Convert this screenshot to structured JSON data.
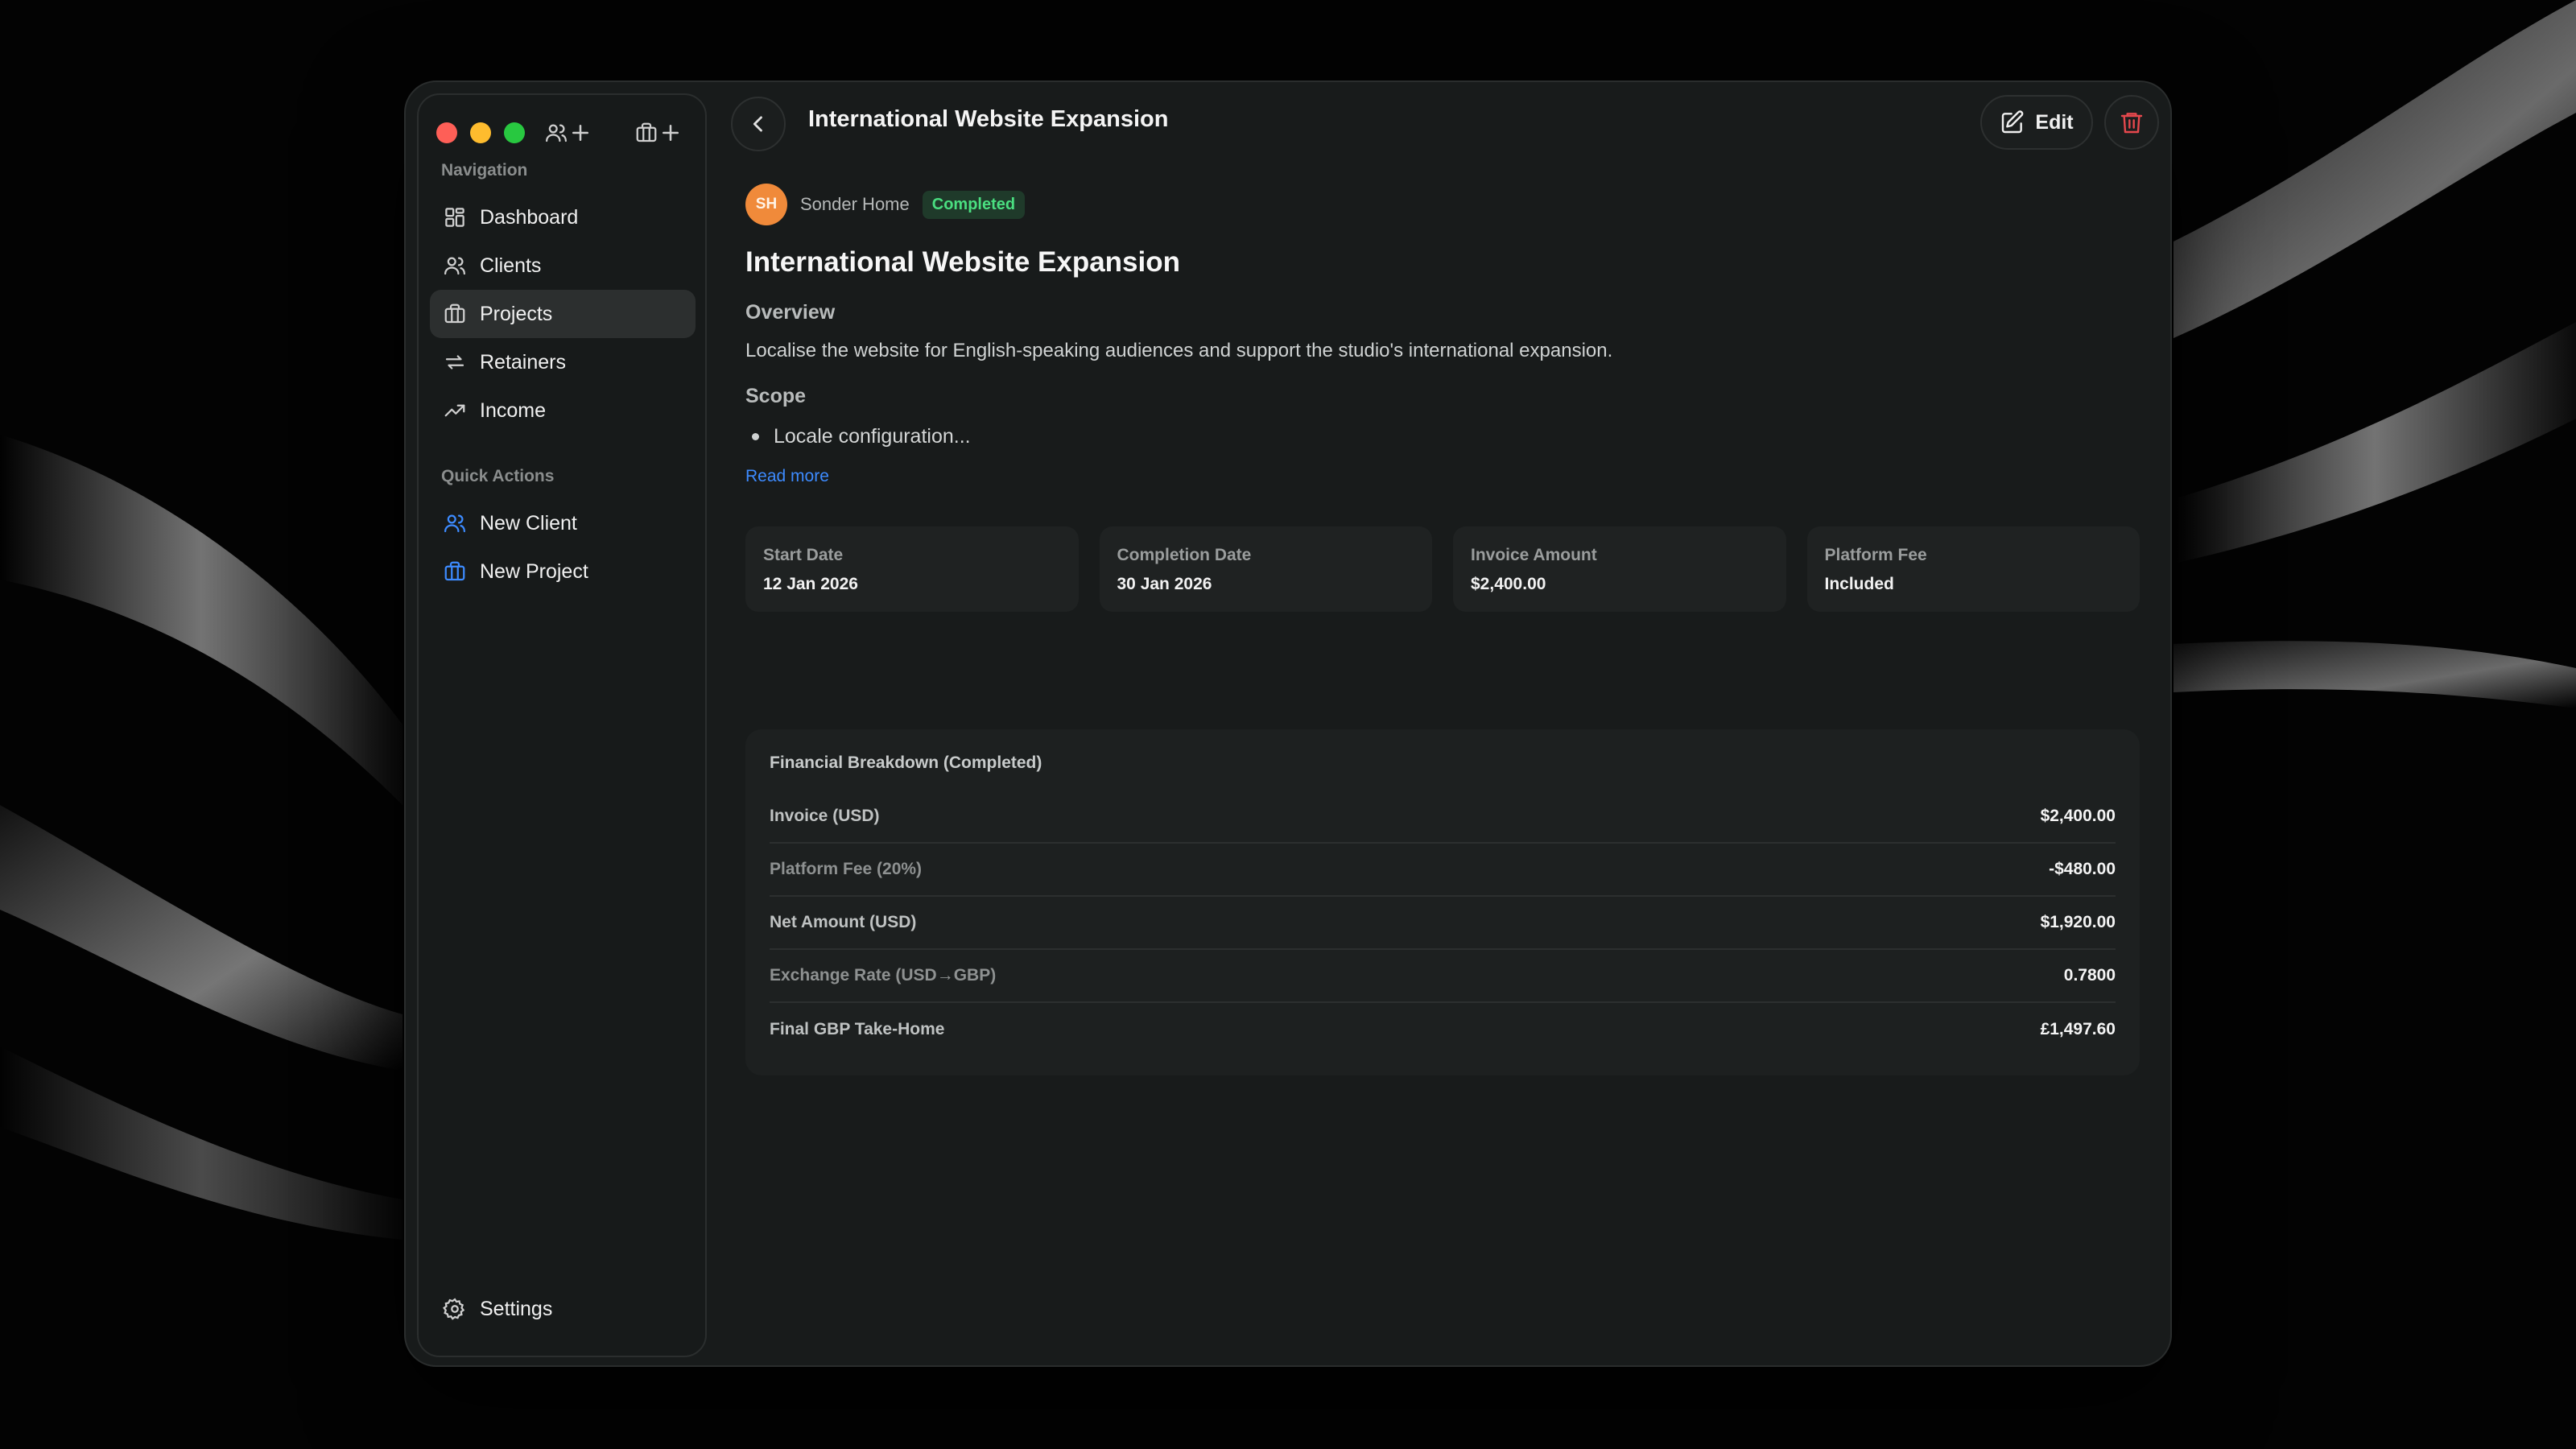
{
  "window": {
    "header_title": "International Website Expansion",
    "edit_label": "Edit"
  },
  "sidebar": {
    "nav_heading": "Navigation",
    "nav_items": [
      {
        "label": "Dashboard",
        "icon": "dashboard-icon"
      },
      {
        "label": "Clients",
        "icon": "users-icon"
      },
      {
        "label": "Projects",
        "icon": "briefcase-icon",
        "active": true
      },
      {
        "label": "Retainers",
        "icon": "repeat-icon"
      },
      {
        "label": "Income",
        "icon": "trending-up-icon"
      }
    ],
    "quick_heading": "Quick Actions",
    "quick_items": [
      {
        "label": "New Client",
        "icon": "users-icon"
      },
      {
        "label": "New Project",
        "icon": "briefcase-icon"
      }
    ],
    "settings_label": "Settings"
  },
  "project": {
    "avatar_initials": "SH",
    "client_name": "Sonder Home",
    "status": "Completed",
    "title": "International Website Expansion",
    "overview_label": "Overview",
    "overview_text": "Localise the website for English-speaking audiences and support the studio's international expansion.",
    "scope_label": "Scope",
    "scope_items": [
      "Locale configuration..."
    ],
    "read_more": "Read more"
  },
  "stats": [
    {
      "label": "Start Date",
      "value": "12 Jan 2026"
    },
    {
      "label": "Completion Date",
      "value": "30 Jan 2026"
    },
    {
      "label": "Invoice Amount",
      "value": "$2,400.00"
    },
    {
      "label": "Platform Fee",
      "value": "Included"
    }
  ],
  "breakdown": {
    "title": "Financial Breakdown (Completed)",
    "rows": [
      {
        "label": "Invoice (USD)",
        "value": "$2,400.00"
      },
      {
        "label": "Platform Fee (20%)",
        "value": "-$480.00"
      },
      {
        "label": "Net Amount (USD)",
        "value": "$1,920.00"
      },
      {
        "label": "Exchange Rate (USD→GBP)",
        "value": "0.7800"
      },
      {
        "label": "Final GBP Take-Home",
        "value": "£1,497.60"
      }
    ]
  },
  "colors": {
    "accent": "#3d8bff",
    "success": "#4ade80",
    "danger": "#e5484d",
    "avatar": "#f08a3a"
  }
}
